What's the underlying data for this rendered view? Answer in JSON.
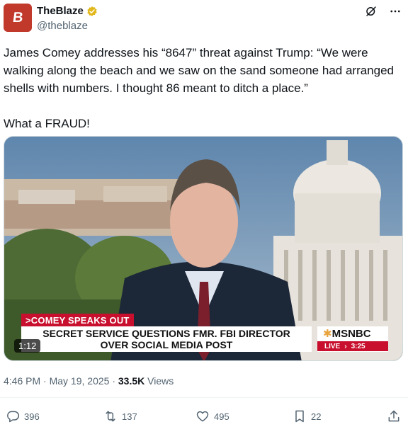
{
  "author": {
    "display_name": "TheBlaze",
    "handle": "@theblaze",
    "avatar_text": "B",
    "avatar_color": "#c0392b",
    "verified_color": "#e2b719"
  },
  "tweet": {
    "text": "James Comey addresses his “8647” threat against Trump: “We were walking along the beach and we saw on the sand someone had arranged shells with numbers. I thought 86 meant to ditch a place.”\n\nWhat a FRAUD!"
  },
  "media": {
    "type": "video",
    "duration": "1:12",
    "lower_third_tag": ">COMEY SPEAKS OUT",
    "headline_line1": "SECRET SERVICE QUESTIONS FMR. FBI DIRECTOR",
    "headline_line2": "OVER SOCIAL MEDIA POST",
    "network": "MSNBC",
    "live_label": "LIVE",
    "live_time": "3:25"
  },
  "meta": {
    "time": "4:46 PM",
    "date": "May 19, 2025",
    "separator": "·",
    "views_count": "33.5K",
    "views_label": "Views"
  },
  "actions": {
    "replies": "396",
    "reposts": "137",
    "likes": "495",
    "bookmarks": "22"
  },
  "icons": [
    "grok-icon",
    "more-icon",
    "reply-icon",
    "repost-icon",
    "like-icon",
    "bookmark-icon",
    "share-icon"
  ]
}
